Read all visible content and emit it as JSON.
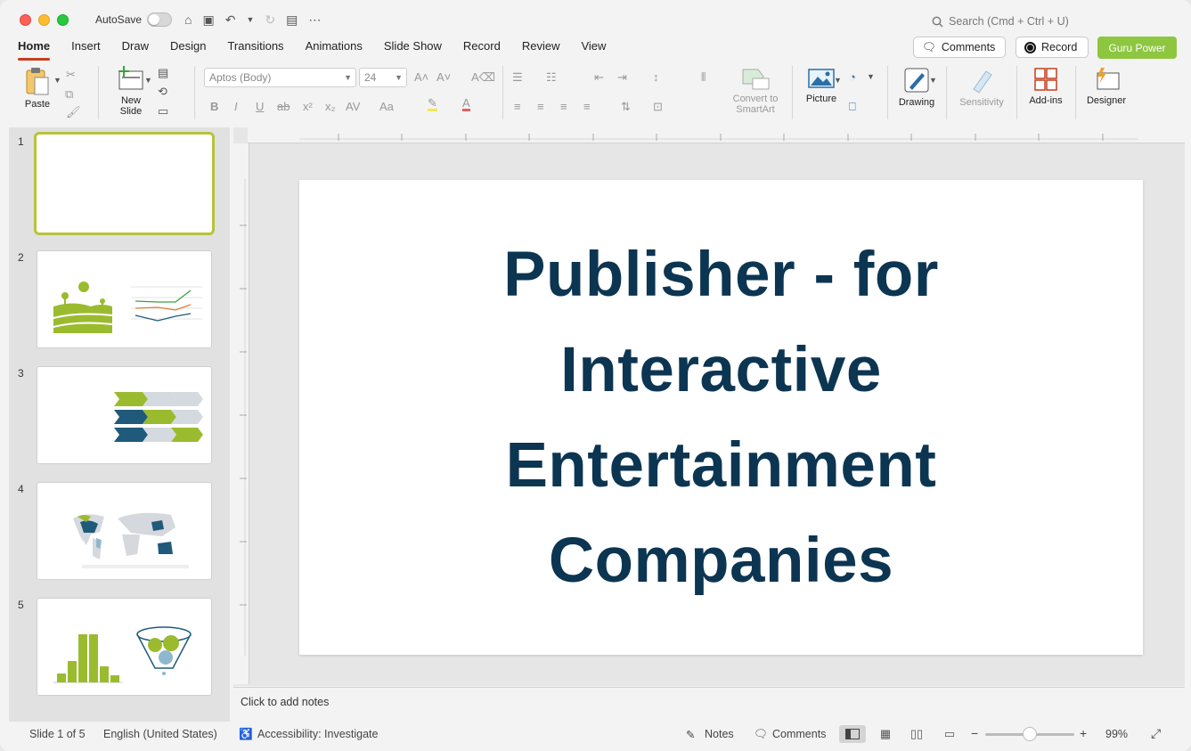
{
  "titlebar": {
    "autosave_label": "AutoSave",
    "search_placeholder": "Search (Cmd + Ctrl + U)"
  },
  "tabs": [
    "Home",
    "Insert",
    "Draw",
    "Design",
    "Transitions",
    "Animations",
    "Slide Show",
    "Record",
    "Review",
    "View"
  ],
  "header_buttons": {
    "comments": "Comments",
    "record": "Record",
    "guru": "Guru Power"
  },
  "ribbon": {
    "paste": "Paste",
    "new_slide": "New Slide",
    "font_name": "Aptos (Body)",
    "font_size": "24",
    "convert_smartart": "Convert to SmartArt",
    "picture": "Picture",
    "drawing": "Drawing",
    "sensitivity": "Sensitivity",
    "addins": "Add-ins",
    "designer": "Designer"
  },
  "thumbnails": [
    {
      "num": "1"
    },
    {
      "num": "2"
    },
    {
      "num": "3"
    },
    {
      "num": "4"
    },
    {
      "num": "5"
    }
  ],
  "slide": {
    "title": "Publisher - for Interactive Entertainment Companies"
  },
  "notes_placeholder": "Click to add notes",
  "status": {
    "slide_count": "Slide 1 of 5",
    "language": "English (United States)",
    "accessibility": "Accessibility: Investigate",
    "notes": "Notes",
    "comments": "Comments",
    "zoom": "99%"
  },
  "colors": {
    "accent_tab": "#c43e1c",
    "guru_green": "#8dc63f",
    "title_navy": "#0c3552",
    "thumb_green": "#9bbb2f",
    "thumb_navy": "#1f5a7a"
  }
}
